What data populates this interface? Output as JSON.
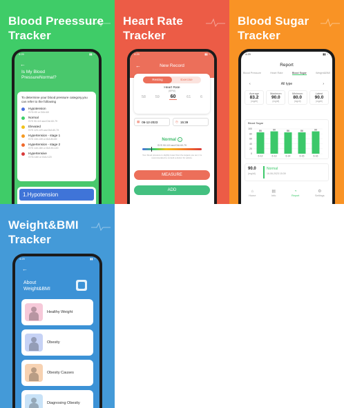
{
  "colors": {
    "green": "#3fcc68",
    "red": "#ec5c46",
    "orange": "#f99325",
    "blue": "#449ad8",
    "bp_list_blue": "#3f74d8",
    "measure_button": "#ec6f5a",
    "add_button": "#44c080",
    "sugar_bar": "#3cc86a"
  },
  "panels": {
    "bp": {
      "title": "Blood Preessure\nTracker",
      "status_time": "4:29",
      "heading": "Is My Blood\nPressureNormal?",
      "intro": "To determine your blood pressure category,you can refer to the following",
      "levels": [
        {
          "name": "Hypotension",
          "range": "SYS<90 or DIA<60",
          "color": "#4a6fe0"
        },
        {
          "name": "Normal",
          "range": "SYS 90-119 and DIA 60-79",
          "color": "#3ecf6a"
        },
        {
          "name": "Elevated",
          "range": "SYS 120-129 and DIA 60-79",
          "color": "#f2c21a"
        },
        {
          "name": "Hypertension - stage 1",
          "range": "SYS 130-139 or DIA 80-89",
          "color": "#f59a22"
        },
        {
          "name": "Hypertension - stage 2",
          "range": "SYS 140-180 or DIA 90-120",
          "color": "#f06a2c"
        },
        {
          "name": "Hypertensive",
          "range": "SYS>180 or DIA>120",
          "color": "#d93a3a"
        }
      ],
      "selected_item": "1.Hypotension"
    },
    "hr": {
      "title": "Heart Rate\nTracker",
      "screen_title": "New Record",
      "status_time": "4:29",
      "tabs": [
        "Resting",
        "Exercise"
      ],
      "heart_rate_label": "Heart Rate",
      "unit": "(BPM)",
      "picker_values": [
        "58",
        "59",
        "60",
        "61",
        "6"
      ],
      "date": "06-12-2023",
      "time": "15:39",
      "status": "Normal",
      "status_range": "SYS 90-119 and DIA 60-79",
      "note": "Your blood pressure is slightly lower than the targets you set, it is recommended to consult a doctor for advice.",
      "measure_label": "MEASURE",
      "add_label": "ADD"
    },
    "bs": {
      "title": "Blood Sugar\nTracker",
      "screen_title": "Report",
      "status_time": "4:29",
      "tabs": [
        "Blood Pressure",
        "Heart Rate",
        "Blood Sugar",
        "Weight&BMI"
      ],
      "active_tab_index": 2,
      "filter_label": "All type",
      "stats": [
        {
          "label": "Average",
          "value": "83.2",
          "unit": "(mg/dl)"
        },
        {
          "label": "Maximum",
          "value": "90.0",
          "unit": "(mg/dl)"
        },
        {
          "label": "Minimum",
          "value": "80.0",
          "unit": "(mg/dl)"
        },
        {
          "label": "Latest",
          "value": "90.0",
          "unit": "(mg/dl)"
        }
      ],
      "record_value": "90.0",
      "record_unit": "(mg/dl)",
      "record_status": "Normal",
      "record_date": "16-06-2023 15:39",
      "nav": [
        "Home",
        "Info",
        "Report",
        "Settings"
      ],
      "active_nav_index": 2
    },
    "wb": {
      "title": "Weight&BMI\nTracker",
      "status_time": "4:29",
      "heading": "About\nWeight&BMI",
      "items": [
        {
          "label": "Healthy Weight",
          "icon": "healthy-weight-icon",
          "bg": "#f6c9d9"
        },
        {
          "label": "Obesity",
          "icon": "obesity-icon",
          "bg": "#c6d2f5"
        },
        {
          "label": "Obesity Causes",
          "icon": "obesity-causes-icon",
          "bg": "#f7d2b2"
        },
        {
          "label": "Diagnosing Obesity",
          "icon": "diagnosing-obesity-icon",
          "bg": "#c8e2f7"
        }
      ]
    }
  },
  "chart_data": {
    "type": "bar",
    "title": "Blood Sugar",
    "categories": [
      "6-12",
      "6-13",
      "6-14",
      "6-15",
      "6-16"
    ],
    "values": [
      86,
      90,
      86,
      86,
      90
    ],
    "data_labels": [
      "86",
      "90",
      "86",
      "86",
      "90"
    ],
    "yticks": [
      "100",
      "80",
      "60",
      "40",
      "20",
      "0"
    ],
    "ylim": [
      0,
      100
    ],
    "grid": true
  }
}
